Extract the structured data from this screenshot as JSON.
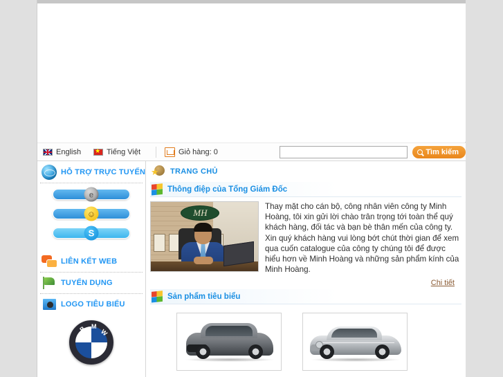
{
  "topbar": {
    "lang_english": "English",
    "lang_vietnamese": "Tiếng Việt",
    "cart_label": "Giỏ hàng: 0",
    "search_value": "",
    "search_placeholder": "",
    "search_button": "Tìm kiếm"
  },
  "sidebar": {
    "support_title": "HỖ TRỢ TRỰC TUYẾN",
    "contacts": [
      {
        "icon": "yahoo-offline-icon",
        "state": "offline"
      },
      {
        "icon": "yahoo-online-icon",
        "state": "online"
      },
      {
        "icon": "skype-icon",
        "state": "skype"
      }
    ],
    "weblinks_title": "LIÊN KẾT WEB",
    "recruitment_title": "TUYỂN DỤNG",
    "logos_title": "LOGO TIÊU BIỂU",
    "logo_items": [
      {
        "name": "BMW",
        "letters": [
          "B",
          "M",
          "W"
        ]
      }
    ]
  },
  "main": {
    "breadcrumb": "TRANG CHỦ",
    "message_title": "Thông điệp của Tổng Giám Đốc",
    "message_body": "Thay mặt cho cán bộ, công nhân viên công ty Minh Hoàng, tôi xin gửi lời chào trân trọng tới toàn thể quý khách hàng, đối tác và bạn bè thân mến của công ty. Xin quý khách hàng vui lòng bớt chút thời gian để xem qua cuốn catalogue của công ty chúng tôi để được hiểu hơn về Minh Hoàng và những sản phẩm kính của Minh Hoàng.",
    "ceo_photo_plaque": "MH",
    "detail_link": "Chi tiết",
    "products_title": "Sản phẩm tiêu biểu",
    "products": [
      {
        "name": "suv-product",
        "alt": "Mazda CX-9 SUV"
      },
      {
        "name": "sedan-product",
        "alt": "Mercedes-Benz CLS Sedan"
      }
    ]
  },
  "colors": {
    "accent_blue": "#1a8fe3",
    "accent_orange": "#e9871c",
    "link_brown": "#8a5a33",
    "page_gray": "#e0e0e0"
  }
}
